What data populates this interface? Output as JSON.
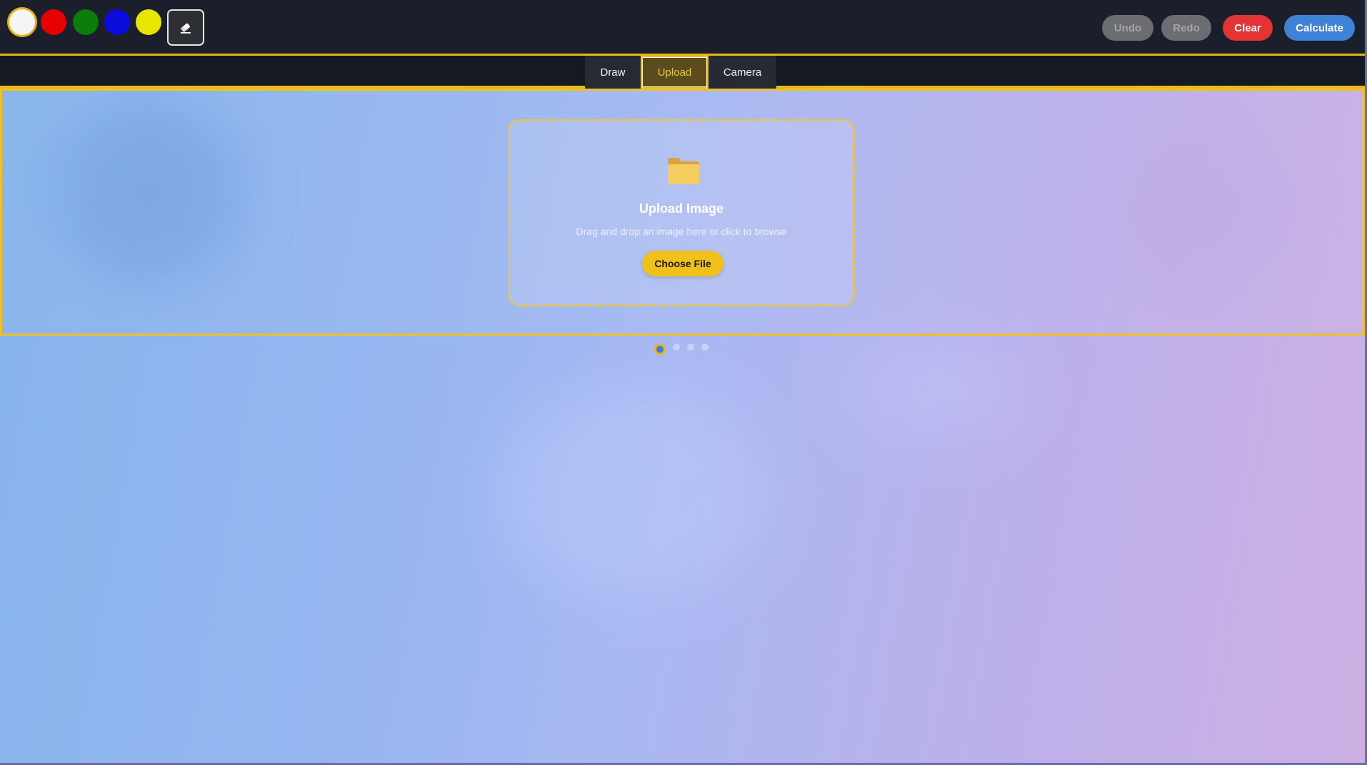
{
  "toolbar": {
    "colors": [
      {
        "name": "white",
        "hex": "#f5f5f5",
        "selected": true
      },
      {
        "name": "red",
        "hex": "#e60000"
      },
      {
        "name": "green",
        "hex": "#0a7d0a"
      },
      {
        "name": "blue",
        "hex": "#0b0bdc"
      },
      {
        "name": "yellow",
        "hex": "#e8e500"
      }
    ],
    "eraser_icon": "eraser-icon",
    "undo_label": "Undo",
    "redo_label": "Redo",
    "clear_label": "Clear",
    "calculate_label": "Calculate",
    "accent_color": "#e9b913"
  },
  "tabs": [
    {
      "label": "Draw",
      "active": false
    },
    {
      "label": "Upload",
      "active": true
    },
    {
      "label": "Camera",
      "active": false
    }
  ],
  "upload": {
    "icon": "folder-icon",
    "title": "Upload Image",
    "subtitle": "Drag and drop an image here or click to browse",
    "button_label": "Choose File"
  },
  "pagination": {
    "total": 4,
    "current": 1
  }
}
